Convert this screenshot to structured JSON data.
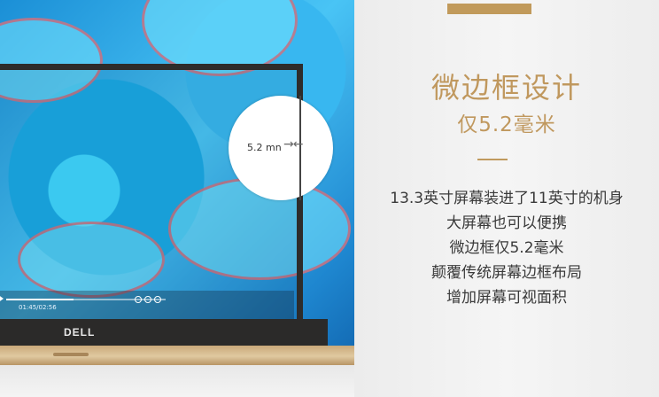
{
  "hero": {
    "measure_label": "5.2 mn",
    "arrows": "→←",
    "brand": "DELL",
    "player_time": "01:45/02:56",
    "progress": 0.42
  },
  "feature": {
    "title": "微边框设计",
    "subtitle": "仅5.2毫米",
    "description": [
      "13.3英寸屏幕装进了11英寸的机身",
      "大屏幕也可以便携",
      "微边框仅5.2毫米",
      "颠覆传统屏幕边框布局",
      "增加屏幕可视面积"
    ]
  },
  "colors": {
    "accent": "#c0985e",
    "text": "#3a3a3a",
    "bezel": "#2b2a29",
    "chassis": "#d6bb8c"
  }
}
